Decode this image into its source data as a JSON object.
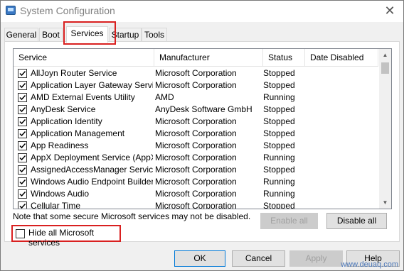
{
  "window": {
    "title": "System Configuration"
  },
  "tabs": [
    {
      "label": "General"
    },
    {
      "label": "Boot"
    },
    {
      "label": "Services"
    },
    {
      "label": "Startup"
    },
    {
      "label": "Tools"
    }
  ],
  "active_tab": "Services",
  "columns": [
    "Service",
    "Manufacturer",
    "Status",
    "Date Disabled"
  ],
  "services": [
    {
      "name": "AllJoyn Router Service",
      "manufacturer": "Microsoft Corporation",
      "status": "Stopped",
      "checked": true
    },
    {
      "name": "Application Layer Gateway Service",
      "manufacturer": "Microsoft Corporation",
      "status": "Stopped",
      "checked": true
    },
    {
      "name": "AMD External Events Utility",
      "manufacturer": "AMD",
      "status": "Running",
      "checked": true
    },
    {
      "name": "AnyDesk Service",
      "manufacturer": "AnyDesk Software GmbH",
      "status": "Stopped",
      "checked": true
    },
    {
      "name": "Application Identity",
      "manufacturer": "Microsoft Corporation",
      "status": "Stopped",
      "checked": true
    },
    {
      "name": "Application Management",
      "manufacturer": "Microsoft Corporation",
      "status": "Stopped",
      "checked": true
    },
    {
      "name": "App Readiness",
      "manufacturer": "Microsoft Corporation",
      "status": "Stopped",
      "checked": true
    },
    {
      "name": "AppX Deployment Service (AppX...",
      "manufacturer": "Microsoft Corporation",
      "status": "Running",
      "checked": true
    },
    {
      "name": "AssignedAccessManager Service",
      "manufacturer": "Microsoft Corporation",
      "status": "Stopped",
      "checked": true
    },
    {
      "name": "Windows Audio Endpoint Builder",
      "manufacturer": "Microsoft Corporation",
      "status": "Running",
      "checked": true
    },
    {
      "name": "Windows Audio",
      "manufacturer": "Microsoft Corporation",
      "status": "Running",
      "checked": true
    },
    {
      "name": "Cellular Time",
      "manufacturer": "Microsoft Corporation",
      "status": "Stopped",
      "checked": true
    }
  ],
  "note": "Note that some secure Microsoft services may not be disabled.",
  "buttons": {
    "enable_all": "Enable all",
    "disable_all": "Disable all",
    "ok": "OK",
    "cancel": "Cancel",
    "apply": "Apply",
    "help": "Help"
  },
  "hide_ms_services": {
    "label": "Hide all Microsoft services",
    "checked": false
  },
  "watermark": "www.deuaq.com",
  "colors": {
    "highlight_border": "#d92020",
    "default_button_border": "#0078d7"
  }
}
